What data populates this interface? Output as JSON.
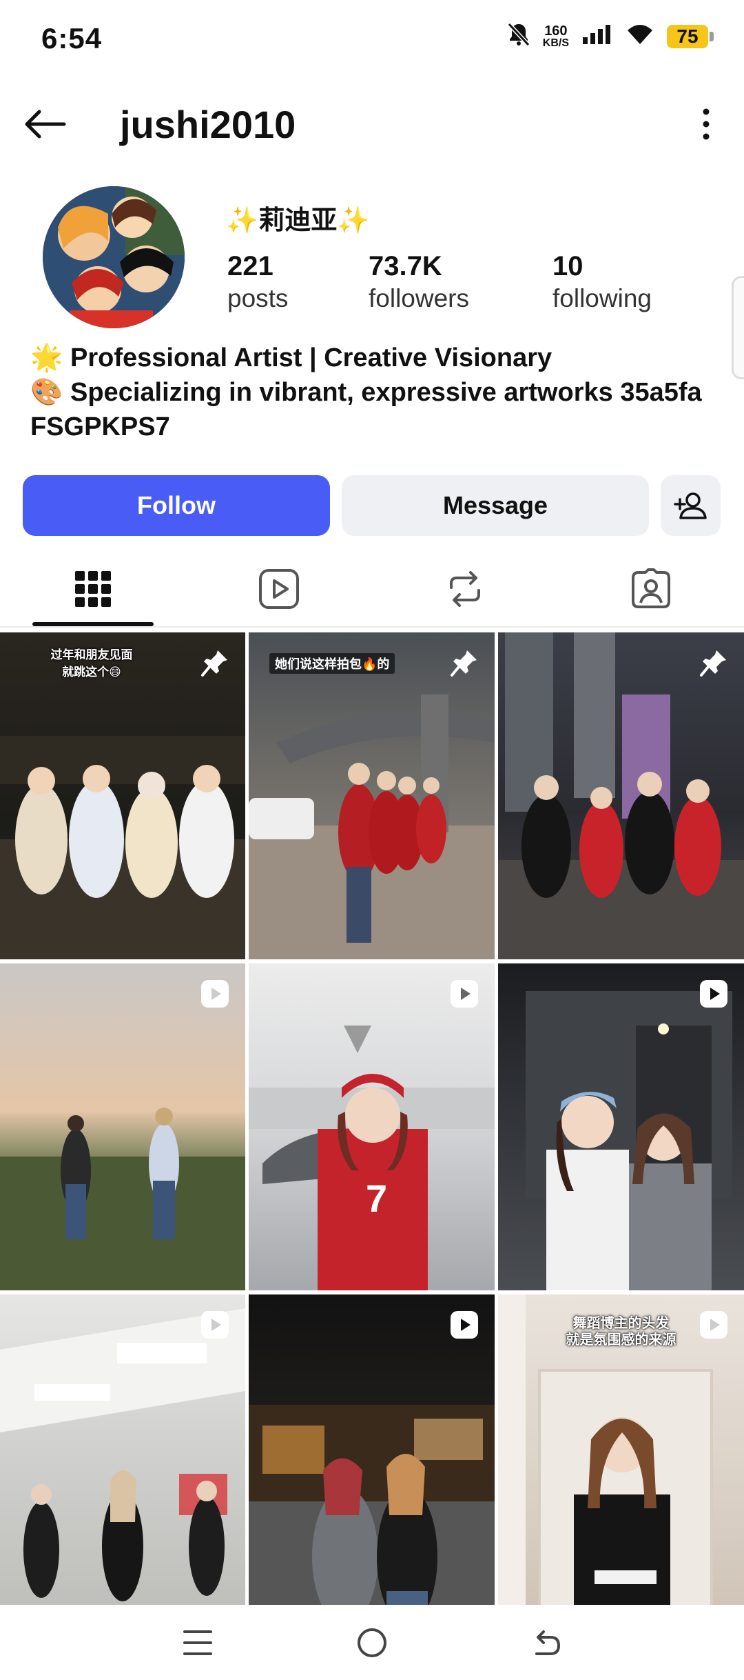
{
  "status_bar": {
    "time": "6:54",
    "net_speed_value": "160",
    "net_speed_unit": "KB/S",
    "battery": "75",
    "icons": [
      "mute-bell-icon",
      "signal-icon",
      "wifi-icon",
      "battery-icon"
    ]
  },
  "header": {
    "username": "jushi2010",
    "back_icon": "arrow-left-icon",
    "menu_icon": "more-vertical-icon"
  },
  "profile": {
    "display_name": "✨莉迪亚✨",
    "stats": {
      "posts": {
        "value": "221",
        "label": "posts"
      },
      "followers": {
        "value": "73.7K",
        "label": "followers"
      },
      "following": {
        "value": "10",
        "label": "following"
      }
    },
    "bio": {
      "line1_emoji": "🌟",
      "line1": "Professional Artist | Creative Visionary",
      "line2_emoji": "🎨",
      "line2": "Specializing in vibrant, expressive artworks 35a5fa",
      "line3": "FSGPKPS7"
    }
  },
  "actions": {
    "follow": "Follow",
    "message": "Message",
    "add_user_icon": "person-add-icon",
    "follow_color": "#4a5cf6"
  },
  "tabs": [
    {
      "name": "grid",
      "icon": "grid-icon",
      "active": true
    },
    {
      "name": "reels",
      "icon": "reels-play-icon",
      "active": false
    },
    {
      "name": "reposts",
      "icon": "repost-icon",
      "active": false
    },
    {
      "name": "tagged",
      "icon": "tagged-person-icon",
      "active": false
    }
  ],
  "grid": {
    "posts": [
      {
        "type": "pinned",
        "caption": "过年和朋友见面\n就跳这个😄"
      },
      {
        "type": "pinned",
        "caption": "她们说这样拍包🔥的"
      },
      {
        "type": "pinned",
        "caption": ""
      },
      {
        "type": "reel",
        "caption": ""
      },
      {
        "type": "reel",
        "caption": ""
      },
      {
        "type": "reel",
        "caption": ""
      },
      {
        "type": "reel",
        "caption": ""
      },
      {
        "type": "reel",
        "caption": ""
      },
      {
        "type": "reel",
        "caption": "舞蹈博主的头发\n就是氛围感的来源"
      }
    ]
  },
  "nav_bar": {
    "icons": [
      "menu-lines-icon",
      "home-circle-icon",
      "back-gesture-icon"
    ]
  }
}
